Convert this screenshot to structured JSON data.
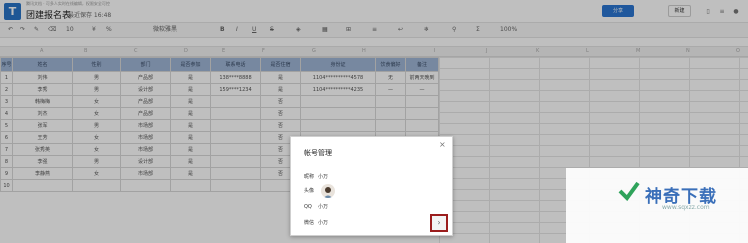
{
  "titlebar": {
    "logo_letter": "T",
    "notice": "腾讯文档 · 可多人实时在线编辑，权限安全可控",
    "doc_title": "团建报名表",
    "save_status": "最近保存 16:48",
    "share_label": "分享",
    "new_label": "新建"
  },
  "toolbar": {
    "font_size": "10",
    "font_family": "微软雅黑",
    "zoom": "100%"
  },
  "col_letters": [
    "A",
    "B",
    "C",
    "D",
    "E",
    "F",
    "G",
    "H",
    "I",
    "J",
    "K",
    "L",
    "M",
    "N",
    "O"
  ],
  "sheet": {
    "headers": [
      "序号",
      "姓名",
      "性别",
      "部门",
      "是否参加",
      "联系电话",
      "是否住宿",
      "身份证",
      "饮食偏好",
      "备注"
    ],
    "rows": [
      [
        "1",
        "刘伟",
        "男",
        "产品部",
        "是",
        "138****8888",
        "是",
        "1104**********4578",
        "无",
        "前两天晚到"
      ],
      [
        "2",
        "李秀",
        "男",
        "设计部",
        "是",
        "159****1234",
        "是",
        "1104**********4235",
        "—",
        "—"
      ],
      [
        "3",
        "韩梅梅",
        "女",
        "产品部",
        "是",
        "",
        "否",
        "",
        "",
        ""
      ],
      [
        "4",
        "刘杰",
        "女",
        "产品部",
        "是",
        "",
        "否",
        "",
        "",
        ""
      ],
      [
        "5",
        "张军",
        "男",
        "市场部",
        "是",
        "",
        "否",
        "",
        "",
        ""
      ],
      [
        "6",
        "王芳",
        "女",
        "市场部",
        "是",
        "",
        "否",
        "",
        "",
        ""
      ],
      [
        "7",
        "张秀英",
        "女",
        "市场部",
        "是",
        "",
        "否",
        "",
        "",
        ""
      ],
      [
        "8",
        "李强",
        "男",
        "设计部",
        "是",
        "",
        "否",
        "",
        "",
        ""
      ],
      [
        "9",
        "李静燕",
        "女",
        "市场部",
        "是",
        "",
        "否",
        "",
        "",
        ""
      ],
      [
        "10",
        "",
        "",
        "",
        "",
        "",
        "",
        "",
        "",
        ""
      ]
    ]
  },
  "modal": {
    "title": "帐号管理",
    "close": "×",
    "nickname_label": "昵称",
    "nickname_value": "小万",
    "avatar_label": "头像",
    "qq_label": "QQ",
    "qq_value": "小万",
    "wechat_label": "微信",
    "wechat_value": "小万",
    "next_glyph": "›"
  },
  "watermark": {
    "brand": "神奇下载",
    "url": "www.sqxzz.com"
  },
  "colors": {
    "accent": "#2b76d2",
    "header_fill": "#9fb6d6",
    "highlight_border": "#9b1d1d"
  }
}
